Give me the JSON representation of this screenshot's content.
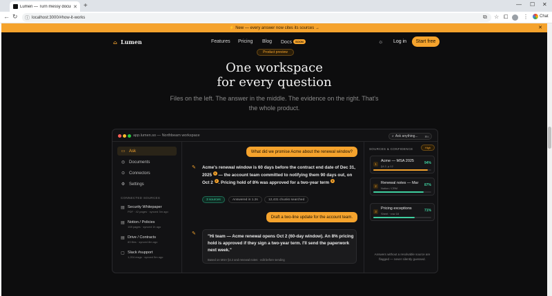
{
  "browser": {
    "tab_title": "Lumen — Turn messy documents...",
    "url": "localhost:3000/#how-it-works",
    "chat_label": "Chat"
  },
  "banner": {
    "text": "⚡ New — every answer now cites its sources →"
  },
  "nav": {
    "logo": "Lumen",
    "links": [
      "Features",
      "Pricing",
      "Blog",
      "Docs"
    ],
    "soon_badge": "SOON",
    "login": "Log in",
    "cta": "Start free"
  },
  "hero": {
    "pill": "Product preview",
    "title_line1": "One workspace",
    "title_line2": "for every question",
    "sub_line1": "Files on the left. The answer in the middle. The evidence on the right. That's",
    "sub_line2": "the whole product."
  },
  "app": {
    "window_title": "app.lumen.so — Northbeam workspace",
    "search_placeholder": "Ask anything...",
    "search_kbd": "⌘K",
    "sidebar": {
      "items": [
        "Ask",
        "Documents",
        "Connectors",
        "Settings"
      ],
      "section_title": "CONNECTED SOURCES",
      "sources": [
        {
          "name": "Security Whitepaper",
          "meta": "PDF · 42 pages · synced 3m ago"
        },
        {
          "name": "Notion / Policies",
          "meta": "108 pages · synced 1h ago"
        },
        {
          "name": "Drive / Contracts",
          "meta": "83 files · synced 8m ago"
        },
        {
          "name": "Slack #support",
          "meta": "1,204 msgs · synced 5m ago"
        }
      ]
    },
    "chat": {
      "question1": "What did we promise Acme about the renewal window?",
      "answer_p1": "Acme's renewal window is 60 days before the contract end date of Dec 31, 2025",
      "answer_p2": " — the account team committed to notifying them 90 days out, on Oct 2",
      "answer_p3": ". Pricing hold of 8% was approved for a two-year term",
      "cites": [
        "1",
        "2",
        "3"
      ],
      "chips": [
        "3 sources",
        "Answered in 1.2s",
        "12,431 chunks searched"
      ],
      "question2": "Draft a two-line update for the account team.",
      "draft": "\"Hi team — Acme renewal opens Oct 2 (60-day window). An 8% pricing hold is approved if they sign a two-year term. I'll send the paperwork next week.\"",
      "draft_note": "Based on MSA §4.2 and renewal notes · edit before sending"
    },
    "panel": {
      "title": "SOURCES & CONFIDENCE",
      "badge": "High",
      "cards": [
        {
          "num": "1",
          "name": "Acme — MSA 2025",
          "meta": "§4.2, p.12",
          "score": "94%",
          "level": 0.94,
          "color": "#f5a32d"
        },
        {
          "num": "2",
          "name": "Renewal notes — Mar",
          "meta": "Notion / CRM",
          "score": "87%",
          "level": 0.87,
          "color": "#3fd0a0"
        },
        {
          "num": "3",
          "name": "Pricing exceptions",
          "meta": "Sheet · row 18",
          "score": "71%",
          "level": 0.71,
          "color": "#3fd0a0"
        }
      ],
      "footer": "Answers without a resolvable source are flagged — never silently guessed."
    }
  }
}
